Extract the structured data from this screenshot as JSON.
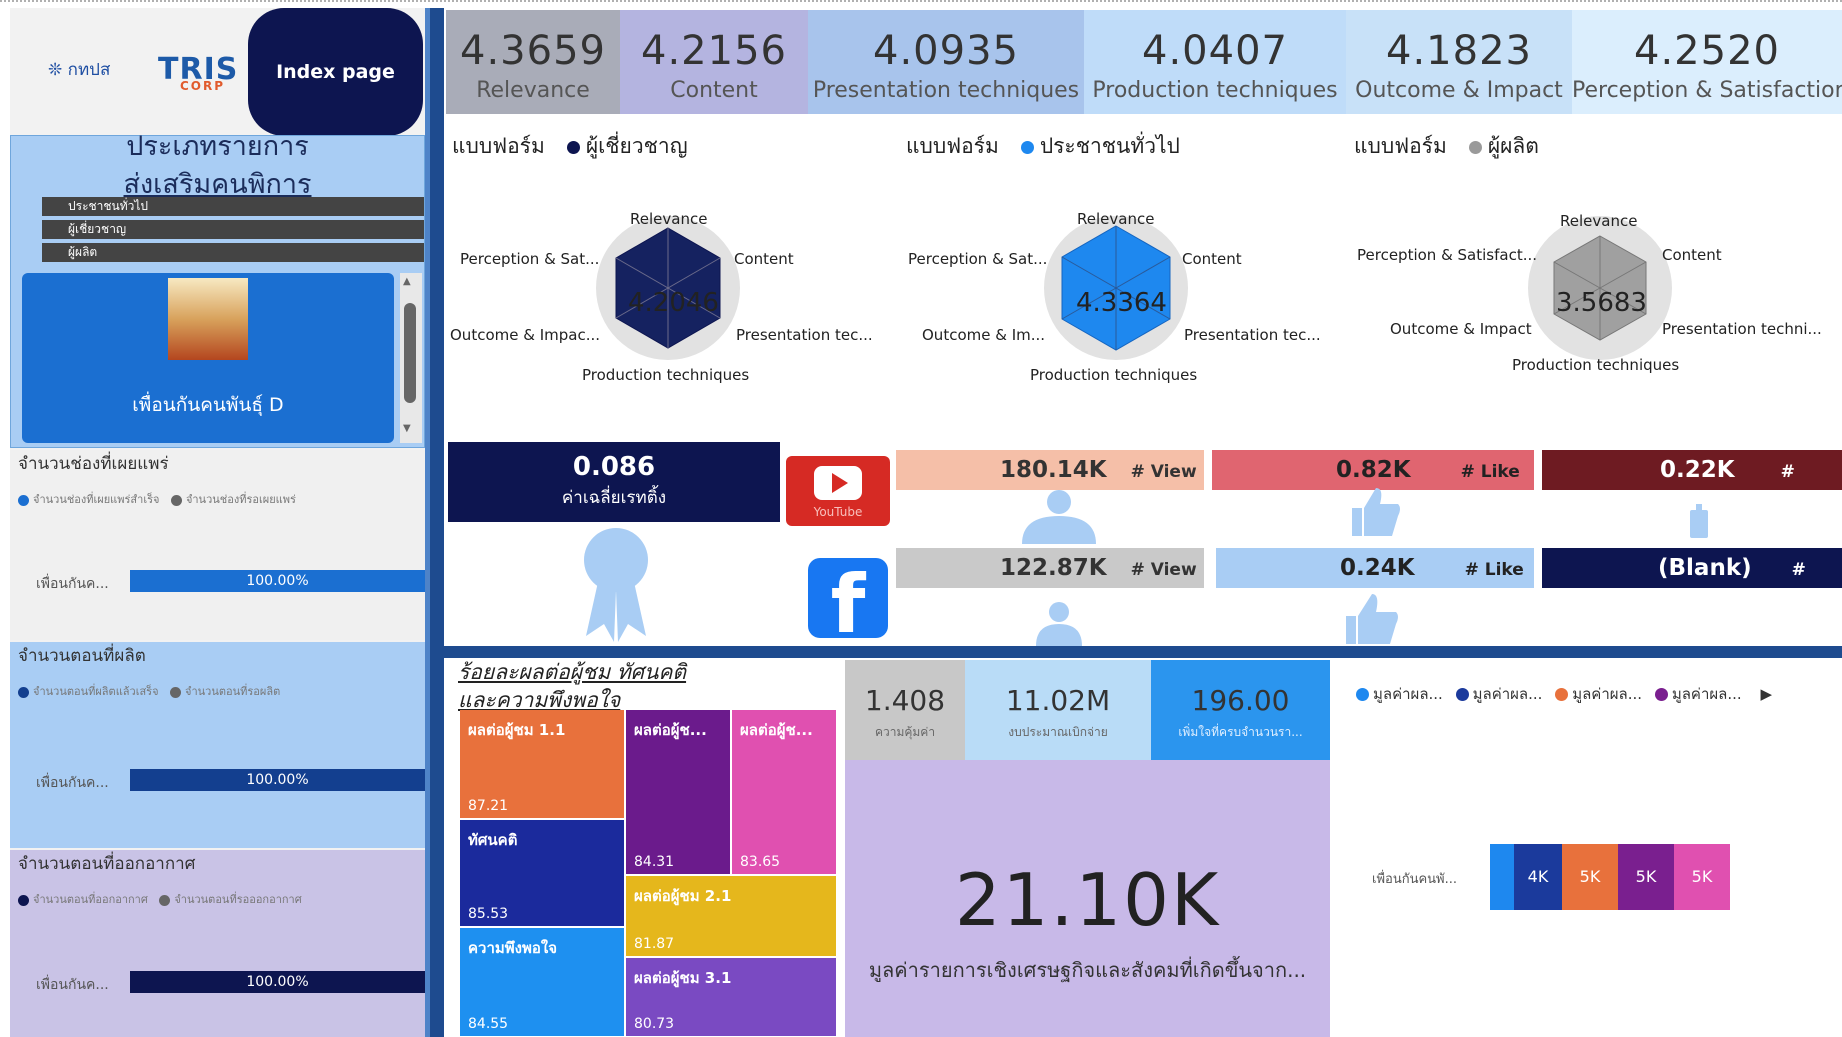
{
  "header": {
    "logo_left": "กทปส",
    "logo_tris": "TRIS",
    "logo_corp": "CORP",
    "index_button": "Index page"
  },
  "sidebar": {
    "type_title_line1": "ประเภทรายการ",
    "type_title_line2": "ส่งเสริมคนพิการ",
    "slicer_items": [
      "ประชาชนทั่วไป",
      "ผู้เชี่ยวชาญ",
      "ผู้ผลิต"
    ],
    "program_card_label": "เพื่อนกันคนพันธุ์ D",
    "sections": [
      {
        "title": "จำนวนช่องที่เผยแพร่",
        "legend_a": "จำนวนช่องที่เผยแพร่สำเร็จ",
        "legend_b": "จำนวนช่องที่รอเผยแพร่",
        "bar_label": "เพื่อนกันค...",
        "bar_value": "100.00%",
        "bar_color": "#1b6fd1"
      },
      {
        "title": "จำนวนตอนที่ผลิต",
        "legend_a": "จำนวนตอนที่ผลิตแล้วเสร็จ",
        "legend_b": "จำนวนตอนที่รอผลิต",
        "bar_label": "เพื่อนกันค...",
        "bar_value": "100.00%",
        "bar_color": "#133f8f"
      },
      {
        "title": "จำนวนตอนที่ออกอากาศ",
        "legend_a": "จำนวนตอนที่ออกอากาศ",
        "legend_b": "จำนวนตอนที่รอออกอากาศ",
        "bar_label": "เพื่อนกันค...",
        "bar_value": "100.00%",
        "bar_color": "#0d1550"
      }
    ]
  },
  "metrics": [
    {
      "value": "4.3659",
      "label": "Relevance",
      "color": "#a9acb8"
    },
    {
      "value": "4.2156",
      "label": "Content",
      "color": "#b4b4e0"
    },
    {
      "value": "4.0935",
      "label": "Presentation techniques",
      "color": "#a8c4ec"
    },
    {
      "value": "4.0407",
      "label": "Production techniques",
      "color": "#bfdcf9"
    },
    {
      "value": "4.1823",
      "label": "Outcome & Impact",
      "color": "#c8e1f8"
    },
    {
      "value": "4.2520",
      "label": "Perception & Satisfaction",
      "color": "#dbeefd"
    }
  ],
  "radars": [
    {
      "form_label": "แบบฟอร์ม",
      "group": "ผู้เชี่ยวชาญ",
      "color": "#0d1550",
      "score": "4.2046",
      "axes": [
        "Relevance",
        "Content",
        "Presentation tec...",
        "Production techniques",
        "Outcome & Impac...",
        "Perception & Sat..."
      ]
    },
    {
      "form_label": "แบบฟอร์ม",
      "group": "ประชาชนทั่วไป",
      "color": "#1e88ef",
      "score": "4.3364",
      "axes": [
        "Relevance",
        "Content",
        "Presentation tec...",
        "Production techniques",
        "Outcome & Im...",
        "Perception & Sat..."
      ]
    },
    {
      "form_label": "แบบฟอร์ม",
      "group": "ผู้ผลิต",
      "color": "#9a9a9a",
      "score": "3.5683",
      "axes": [
        "Relevance",
        "Content",
        "Presentation techni...",
        "Production techniques",
        "Outcome & Impact",
        "Perception & Satisfact..."
      ]
    }
  ],
  "media": {
    "rating_value": "0.086",
    "rating_label": "ค่าเฉลี่ยเรทติ้ง",
    "youtube_label": "YouTube",
    "youtube": {
      "view": "180.14K",
      "view_tag": "# View",
      "like": "0.82K",
      "like_tag": "# Like",
      "share": "0.22K",
      "share_tag": "# Share"
    },
    "facebook": {
      "view": "122.87K",
      "view_tag": "# View",
      "like": "0.24K",
      "like_tag": "# Like",
      "share": "(Blank)",
      "share_tag": "# Share"
    }
  },
  "treemap": {
    "title_line1": "ร้อยละผลต่อผู้ชม ทัศนคติ",
    "title_line2": "และความพึงพอใจ",
    "cells": [
      {
        "label": "ผลต่อผู้ชม 1.1",
        "value": "87.21",
        "color": "#e8713c"
      },
      {
        "label": "ผลต่อผู้ช...",
        "value": "84.31",
        "color": "#6b1b8c"
      },
      {
        "label": "ผลต่อผู้ช...",
        "value": "83.65",
        "color": "#e050b0"
      },
      {
        "label": "ทัศนคติ",
        "value": "85.53",
        "color": "#1b2a9c"
      },
      {
        "label": "ผลต่อผู้ชม 2.1",
        "value": "81.87",
        "color": "#e5b71c"
      },
      {
        "label": "ความพึงพอใจ",
        "value": "84.55",
        "color": "#1e90f0"
      },
      {
        "label": "ผลต่อผู้ชม 3.1",
        "value": "80.73",
        "color": "#7a4ac2"
      }
    ]
  },
  "kpis": [
    {
      "value": "1.408",
      "label": "ความคุ้มค่า",
      "color": "#c8c8c8"
    },
    {
      "value": "11.02M",
      "label": "งบประมาณเบิกจ่าย",
      "color": "#b9dcf7"
    },
    {
      "value": "196.00",
      "label": "เพิ่มใจที่ครบจำนวนรา...",
      "color": "#2b95ee"
    }
  ],
  "economic": {
    "value": "21.10K",
    "label": "มูลค่ารายการเชิงเศรษฐกิจและสังคมที่เกิดขึ้นจาก..."
  },
  "value_chart": {
    "legend": [
      {
        "name": "มูลค่าผล...",
        "color": "#1e88ef"
      },
      {
        "name": "มูลค่าผล...",
        "color": "#1b3a9c"
      },
      {
        "name": "มูลค่าผล...",
        "color": "#e8713c"
      },
      {
        "name": "มูลค่าผล...",
        "color": "#7a1f8f"
      }
    ],
    "row_label": "เพื่อนกันคนพั...",
    "segments": [
      {
        "label": "",
        "color": "#1e88ef"
      },
      {
        "label": "4K",
        "color": "#1b3a9c"
      },
      {
        "label": "5K",
        "color": "#e8713c"
      },
      {
        "label": "5K",
        "color": "#7a1f8f"
      },
      {
        "label": "5K",
        "color": "#e050b0"
      }
    ]
  }
}
